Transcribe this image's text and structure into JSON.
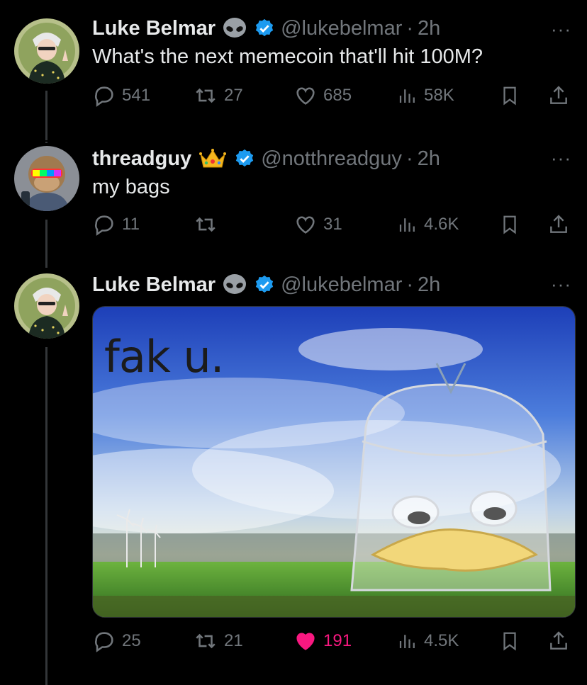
{
  "tweets": [
    {
      "name": "Luke Belmar",
      "handle": "@lukebelmar",
      "time": "2h",
      "text": "What's the next memecoin that'll hit 100M?",
      "replies": "541",
      "retweets": "27",
      "likes": "685",
      "views": "58K",
      "liked": false
    },
    {
      "name": "threadguy",
      "handle": "@notthreadguy",
      "time": "2h",
      "text": "my bags",
      "replies": "11",
      "retweets": "",
      "likes": "31",
      "views": "4.6K",
      "liked": false
    },
    {
      "name": "Luke Belmar",
      "handle": "@lukebelmar",
      "time": "2h",
      "media_caption": "fak u.",
      "replies": "25",
      "retweets": "21",
      "likes": "191",
      "views": "4.5K",
      "liked": true
    }
  ],
  "separator": "·",
  "more_glyph": "···",
  "colors": {
    "background": "#000000",
    "primary_text": "#e7e9ea",
    "secondary_text": "#71767b",
    "verified_blue": "#1d9bf0",
    "liked_pink": "#f91880",
    "thread_line": "#333639"
  },
  "icons": [
    "alien-icon",
    "verified-badge-icon",
    "crown-icon",
    "reply-icon",
    "retweet-icon",
    "heart-icon",
    "views-icon",
    "bookmark-icon",
    "share-icon",
    "more-icon"
  ]
}
